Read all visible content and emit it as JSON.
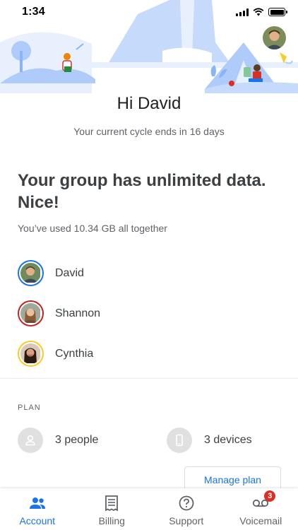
{
  "status_bar": {
    "time": "1:34"
  },
  "header": {
    "greeting": "Hi David",
    "cycle_text": "Your current cycle ends in 16 days"
  },
  "data_summary": {
    "headline": "Your group has unlimited data. Nice!",
    "usage_text": "You’ve used 10.34 GB all together"
  },
  "members": [
    {
      "name": "David",
      "ring_color": "#1a73e8"
    },
    {
      "name": "Shannon",
      "ring_color": "#c5221f"
    },
    {
      "name": "Cynthia",
      "ring_color": "#f9cb28"
    }
  ],
  "plan": {
    "label": "PLAN",
    "people": "3 people",
    "devices": "3 devices",
    "manage_label": "Manage plan"
  },
  "bottom_nav": {
    "account": "Account",
    "billing": "Billing",
    "support": "Support",
    "voicemail": "Voicemail",
    "voicemail_badge": "3"
  },
  "colors": {
    "accent": "#1a73e8",
    "badge": "#d93025",
    "illustration": "#aecbfa"
  }
}
